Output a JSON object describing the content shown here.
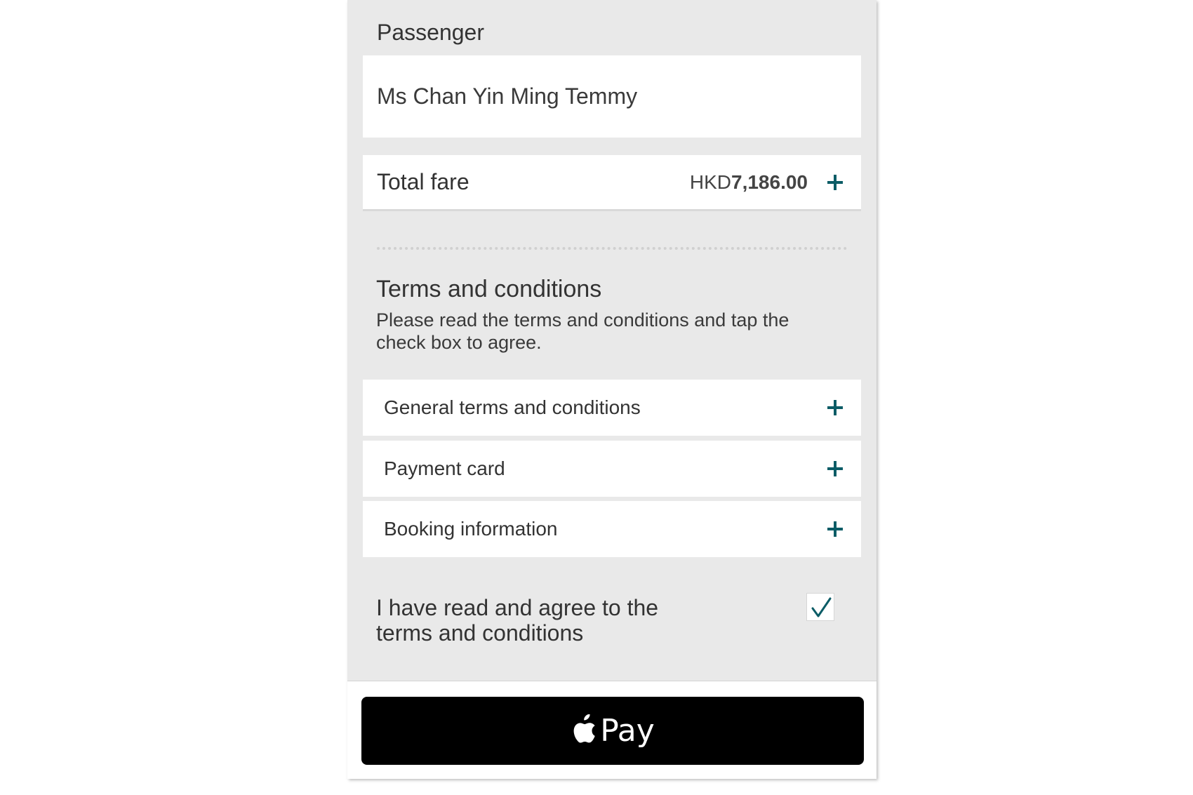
{
  "passenger": {
    "label": "Passenger",
    "name": "Ms Chan Yin Ming Temmy"
  },
  "fare": {
    "label": "Total fare",
    "currency": "HKD",
    "amount": "7,186.00",
    "expand_icon": "plus-icon"
  },
  "terms": {
    "title": "Terms and conditions",
    "description": "Please read the terms and conditions and tap the check box to agree.",
    "items": [
      {
        "label": "General terms and conditions",
        "icon": "plus-icon"
      },
      {
        "label": "Payment card",
        "icon": "plus-icon"
      },
      {
        "label": "Booking information",
        "icon": "plus-icon"
      }
    ],
    "agree_text": "I have read and agree to the terms and conditions",
    "agree_checked": true
  },
  "payment": {
    "button_label": "Pay",
    "icon": "apple-logo-icon"
  },
  "colors": {
    "accent": "#0b5c66",
    "background": "#e9e9e9",
    "card": "#ffffff",
    "pay_button": "#000000"
  }
}
